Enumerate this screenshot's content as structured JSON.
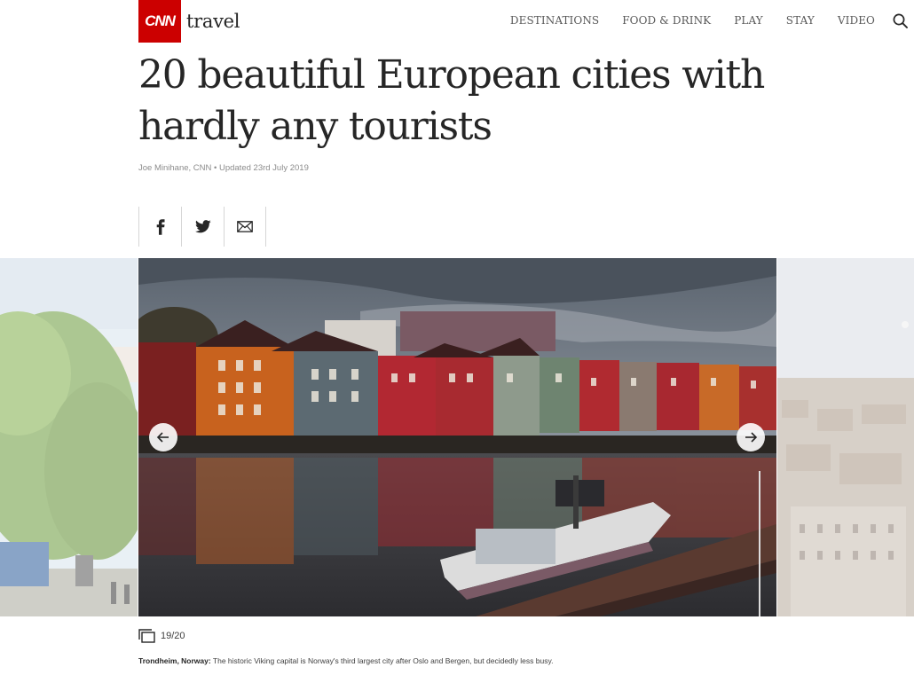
{
  "header": {
    "logo_mark": "CNN",
    "logo_text": "travel",
    "nav": [
      "DESTINATIONS",
      "FOOD & DRINK",
      "PLAY",
      "STAY",
      "VIDEO"
    ],
    "search_icon": "search-icon"
  },
  "article": {
    "title": "20 beautiful European cities with hardly any tourists",
    "byline": "Joe Minihane, CNN • Updated 23rd July 2019"
  },
  "share": {
    "icons": [
      "facebook-icon",
      "twitter-icon",
      "email-icon"
    ]
  },
  "gallery": {
    "counter": "19/20",
    "caption_location": "Trondheim, Norway:",
    "caption_text": " The historic Viking capital is Norway's third largest city after Oslo and Bergen, but decidedly less busy."
  },
  "colors": {
    "brand_red": "#cc0000",
    "text_dark": "#262626",
    "text_muted": "#8c8c8c"
  }
}
